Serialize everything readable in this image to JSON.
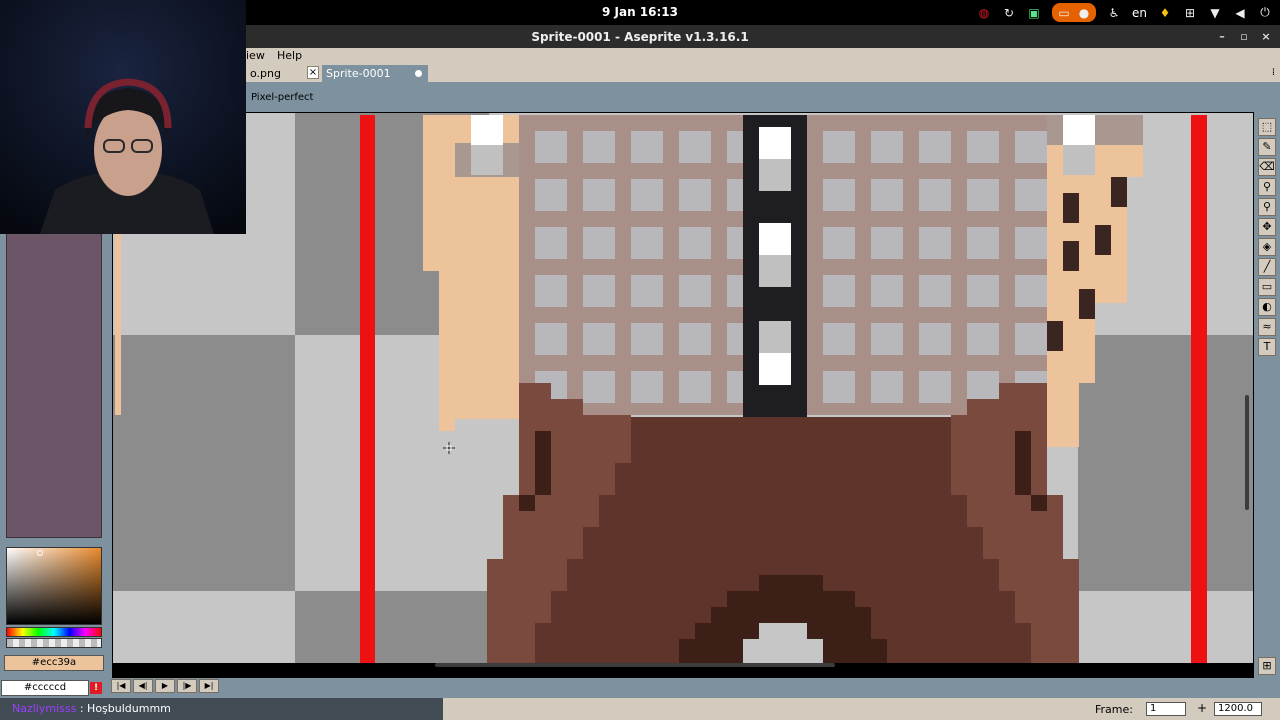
{
  "system": {
    "clock": "9 Jan  16:13",
    "language": "en",
    "tray_icons": [
      "screencast-icon",
      "refresh-icon",
      "lock-icon",
      "cast-icon",
      "recording-dot-icon",
      "accessibility-icon",
      "microphone-icon",
      "network-icon",
      "wifi-icon",
      "volume-icon",
      "power-icon"
    ]
  },
  "window": {
    "title": "Sprite-0001 - Aseprite v1.3.16.1",
    "controls": {
      "minimize": "–",
      "maximize": "▫",
      "close": "×"
    }
  },
  "menu": {
    "items": [
      "iew",
      "Help"
    ]
  },
  "tabs": [
    {
      "label": "o.png",
      "close": "×"
    },
    {
      "label": "Sprite-0001"
    }
  ],
  "context_bar": {
    "pixel_perfect_label": "Pixel-perfect"
  },
  "colors": {
    "foreground_hex": "#ecc39a",
    "background_hex": "#cccccd",
    "accent_chrome": "#7d929e",
    "panel_beige": "#d3cbbe",
    "palette_purple": "#6b5566"
  },
  "toolbar": {
    "tools": [
      {
        "name": "marquee-tool-icon",
        "glyph": "⬚"
      },
      {
        "name": "pencil-tool-icon",
        "glyph": "✎"
      },
      {
        "name": "eraser-tool-icon",
        "glyph": "⌫"
      },
      {
        "name": "eyedropper-tool-icon",
        "glyph": "⚲"
      },
      {
        "name": "zoom-tool-icon",
        "glyph": "⚲"
      },
      {
        "name": "move-tool-icon",
        "glyph": "✥"
      },
      {
        "name": "fill-tool-icon",
        "glyph": "◈"
      },
      {
        "name": "line-tool-icon",
        "glyph": "╱"
      },
      {
        "name": "rectangle-tool-icon",
        "glyph": "▭"
      },
      {
        "name": "contour-tool-icon",
        "glyph": "◐"
      },
      {
        "name": "blur-tool-icon",
        "glyph": "≈"
      },
      {
        "name": "text-tool-icon",
        "glyph": "T"
      }
    ],
    "bottom_icon": "⊞"
  },
  "playback": {
    "first": "|◀",
    "prev": "◀|",
    "play": "▶",
    "next": "|▶",
    "last": "▶|"
  },
  "status": {
    "chat_user": "Nazliymisss",
    "chat_sep": " : ",
    "chat_message": "Hoşbuldummm",
    "frame_label": "Frame:",
    "frame_value": "1",
    "add_frame": "+",
    "zoom": "1200.0"
  }
}
